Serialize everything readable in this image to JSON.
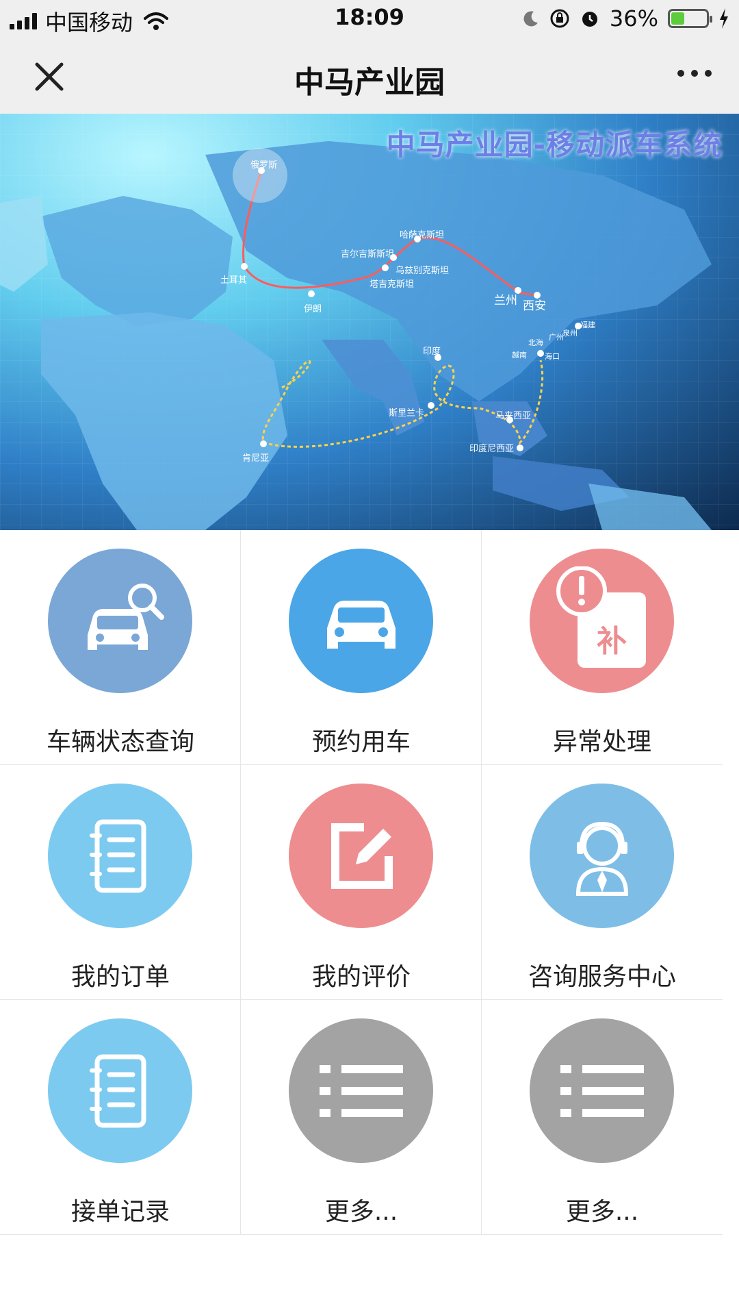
{
  "status_bar": {
    "carrier": "中国移动",
    "time": "18:09",
    "battery": "36%",
    "battery_level": 0.36
  },
  "nav": {
    "title": "中马产业园",
    "close_icon": "close-icon",
    "more_icon": "more-icon"
  },
  "banner": {
    "title": "中马产业园-移动派车系统",
    "cities": [
      "俄罗斯",
      "土耳其",
      "伊朗",
      "吉尔吉斯斯坦",
      "哈萨克斯坦",
      "乌兹别克斯坦",
      "塔吉克斯坦",
      "兰州",
      "西安",
      "福建",
      "广州",
      "泉州",
      "北海",
      "越南",
      "海口",
      "印度",
      "斯里兰卡",
      "马来西亚",
      "印度尼西亚",
      "肯尼亚"
    ]
  },
  "menu": [
    {
      "label": "车辆状态查询",
      "icon": "car-search-icon",
      "color": "#7aa7d6"
    },
    {
      "label": "预约用车",
      "icon": "car-icon",
      "color": "#4aa6e6"
    },
    {
      "label": "异常处理",
      "icon": "exception-supplement-icon",
      "color": "#ee8d8f"
    },
    {
      "label": "我的订单",
      "icon": "notebook-icon",
      "color": "#7ccaf0"
    },
    {
      "label": "我的评价",
      "icon": "edit-icon",
      "color": "#ee8d8f"
    },
    {
      "label": "咨询服务中心",
      "icon": "customer-service-icon",
      "color": "#7ebee6"
    },
    {
      "label": "接单记录",
      "icon": "notebook-icon",
      "color": "#7ccaf0"
    },
    {
      "label": "更多...",
      "icon": "list-icon",
      "color": "#a3a3a3"
    },
    {
      "label": "更多...",
      "icon": "list-icon",
      "color": "#a3a3a3"
    }
  ]
}
